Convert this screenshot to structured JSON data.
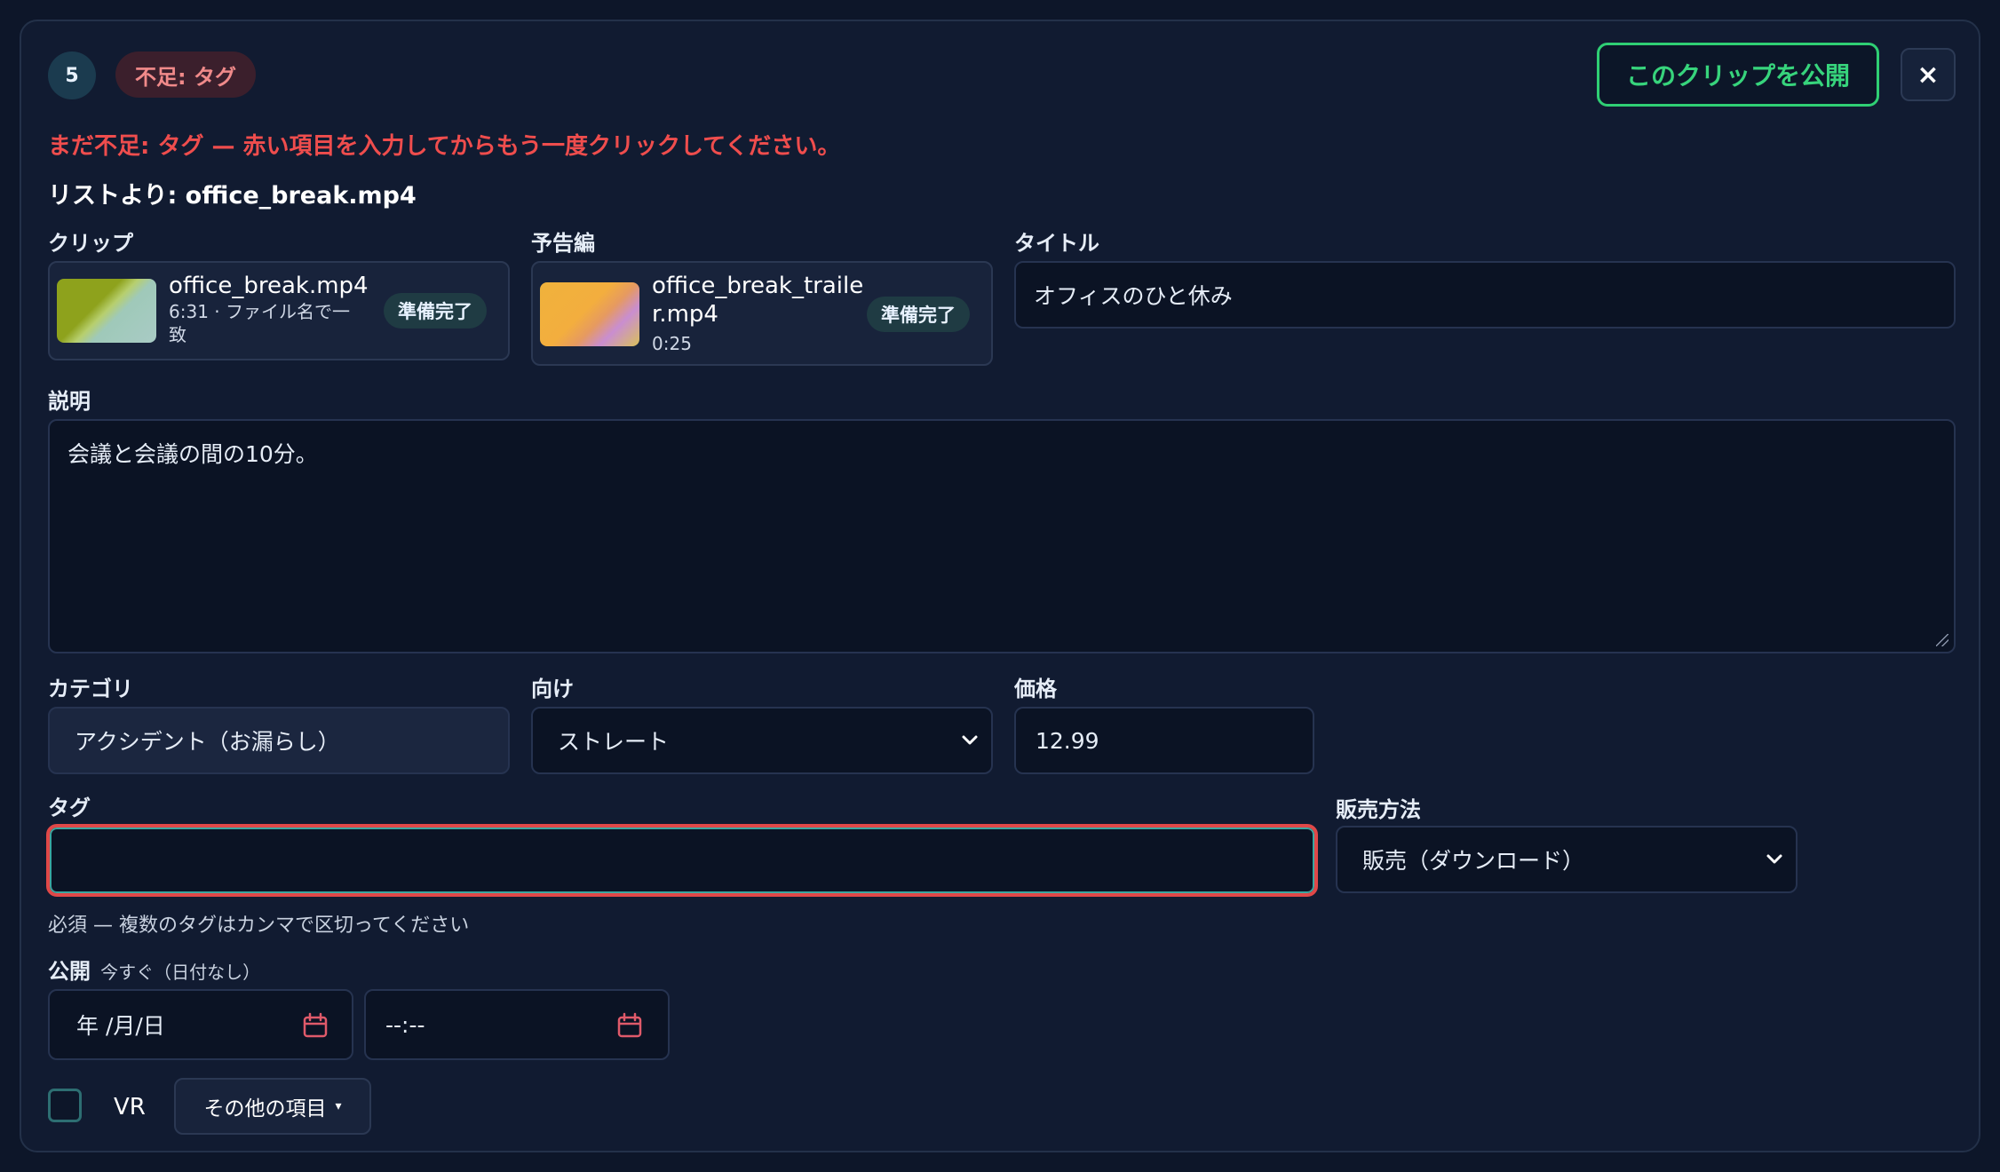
{
  "header": {
    "index_badge": "5",
    "missing_badge": "不足: タグ",
    "publish_button": "このクリップを公開",
    "close_button": "×",
    "warning": "まだ不足: タグ — 赤い項目を入力してからもう一度クリックしてください。",
    "from_list_prefix": "リストより: ",
    "from_list_file": "office_break.mp4"
  },
  "clip": {
    "label": "クリップ",
    "filename": "office_break.mp4",
    "meta_line1": "6:31 · ファイル名で一",
    "meta_line2": "致",
    "status": "準備完了"
  },
  "trailer": {
    "label": "予告編",
    "filename_line1": "office_break_traile",
    "filename_line2": "r.mp4",
    "duration": "0:25",
    "status": "準備完了"
  },
  "title_field": {
    "label": "タイトル",
    "value": "オフィスのひと休み"
  },
  "description": {
    "label": "説明",
    "value": "会議と会議の間の10分。"
  },
  "category": {
    "label": "カテゴリ",
    "value": "アクシデント（お漏らし）"
  },
  "audience": {
    "label": "向け",
    "value": "ストレート",
    "chevron": "chevron-down-icon"
  },
  "price": {
    "label": "価格",
    "value": "12.99"
  },
  "tags": {
    "label": "タグ",
    "value": "",
    "hint": "必須 — 複数のタグはカンマで区切ってください",
    "error_color": "#e04848"
  },
  "sales_method": {
    "label": "販売方法",
    "value": "販売（ダウンロード）"
  },
  "publish": {
    "label": "公開",
    "sub_label": "今すぐ（日付なし）",
    "date_placeholder": "年 /月/日",
    "time_placeholder": "--:--"
  },
  "vr": {
    "label": "VR",
    "checked": false
  },
  "more_button": {
    "label": "その他の項目",
    "caret": "▾"
  },
  "colors": {
    "accent_green": "#37d47c",
    "error_red": "#ef4d4d",
    "background": "#0d1629"
  }
}
